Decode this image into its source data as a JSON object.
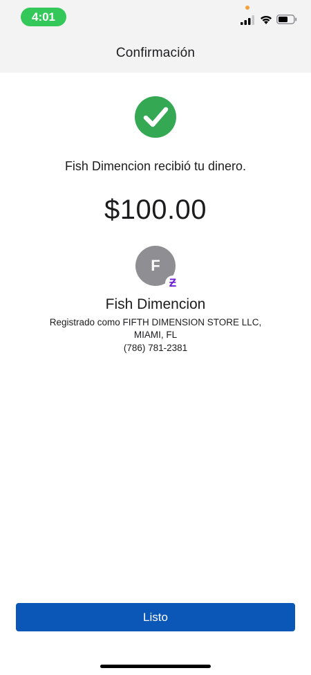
{
  "status_bar": {
    "time": "4:01",
    "icons": [
      "signal-icon",
      "wifi-icon",
      "battery-icon"
    ]
  },
  "header": {
    "title": "Confirmación"
  },
  "confirmation": {
    "status_icon": "checkmark-circle-icon",
    "message": "Fish Dimencion recibió tu dinero.",
    "amount": "$100.00"
  },
  "recipient": {
    "avatar_initial": "F",
    "badge_icon": "zelle-icon",
    "badge_glyph": "Ƶ",
    "name": "Fish Dimencion",
    "registered_as": "Registrado como FIFTH DIMENSION STORE LLC,",
    "location": "MIAMI, FL",
    "phone": "(786) 781-2381"
  },
  "actions": {
    "done_label": "Listo"
  },
  "colors": {
    "success_green": "#34a853",
    "status_time_bg": "#34c759",
    "primary_button": "#0a57b8",
    "avatar_gray": "#8e8e93",
    "zelle_purple": "#6d1ed4",
    "header_bg": "#f3f3f4"
  }
}
